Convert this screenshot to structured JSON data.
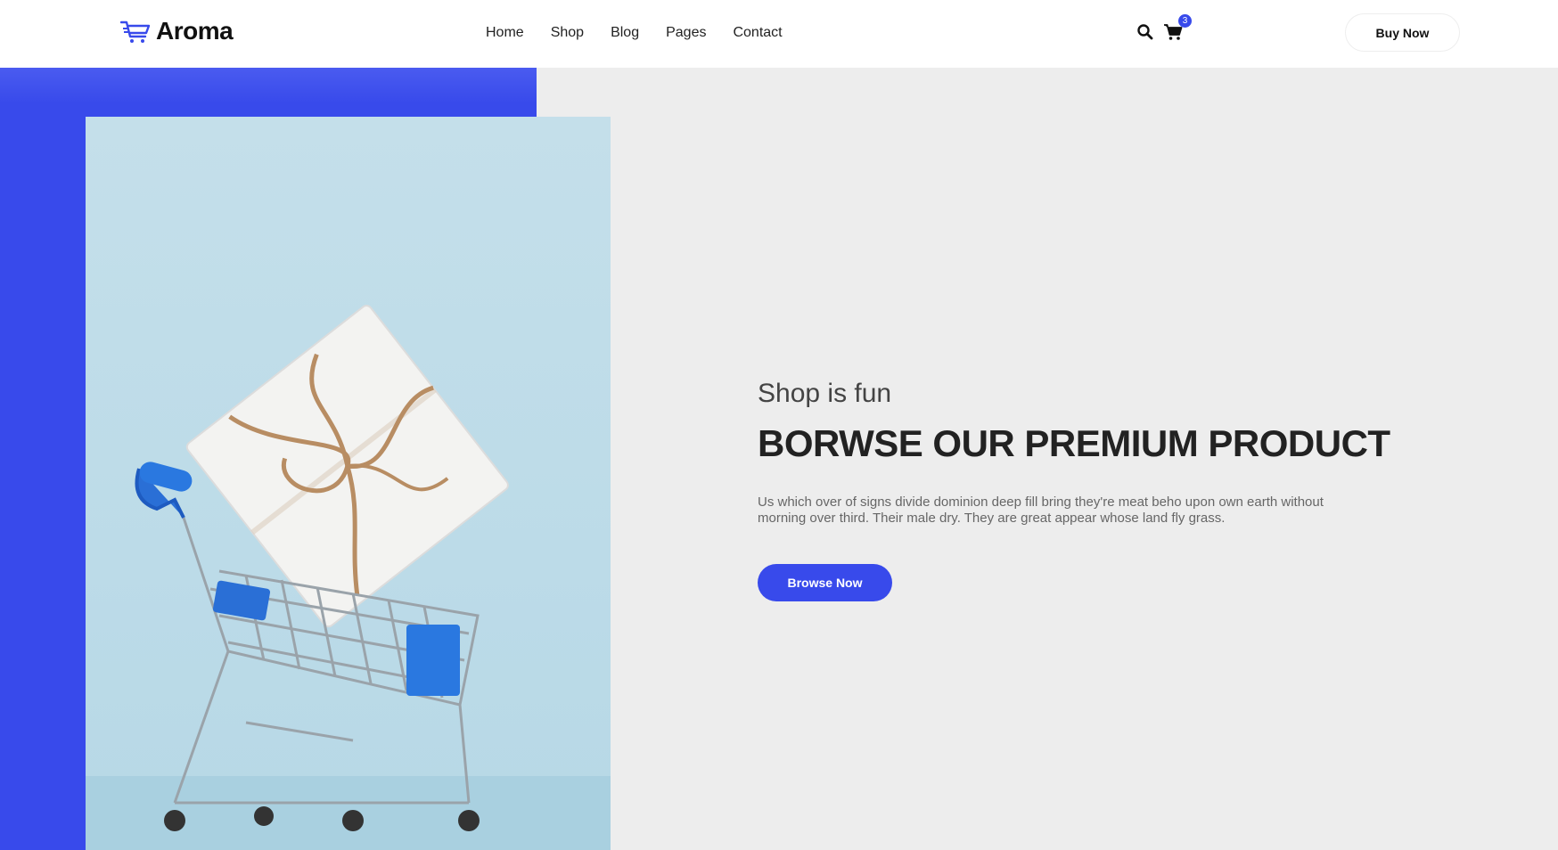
{
  "brand": {
    "name": "Aroma",
    "accent_color": "#384aeb"
  },
  "nav": {
    "items": [
      {
        "label": "Home"
      },
      {
        "label": "Shop"
      },
      {
        "label": "Blog"
      },
      {
        "label": "Pages"
      },
      {
        "label": "Contact"
      }
    ]
  },
  "header": {
    "search_icon": "search-icon",
    "cart_icon": "cart-icon",
    "cart_count": "3",
    "buy_now_label": "Buy Now"
  },
  "hero": {
    "subtitle": "Shop is fun",
    "headline": "BORWSE OUR PREMIUM PRODUCT",
    "description": "Us which over of signs divide dominion deep fill bring they're meat beho upon own earth without morning over third. Their male dry. They are great appear whose land fly grass.",
    "cta_label": "Browse Now",
    "image": "shopping-cart-with-gift-box"
  }
}
